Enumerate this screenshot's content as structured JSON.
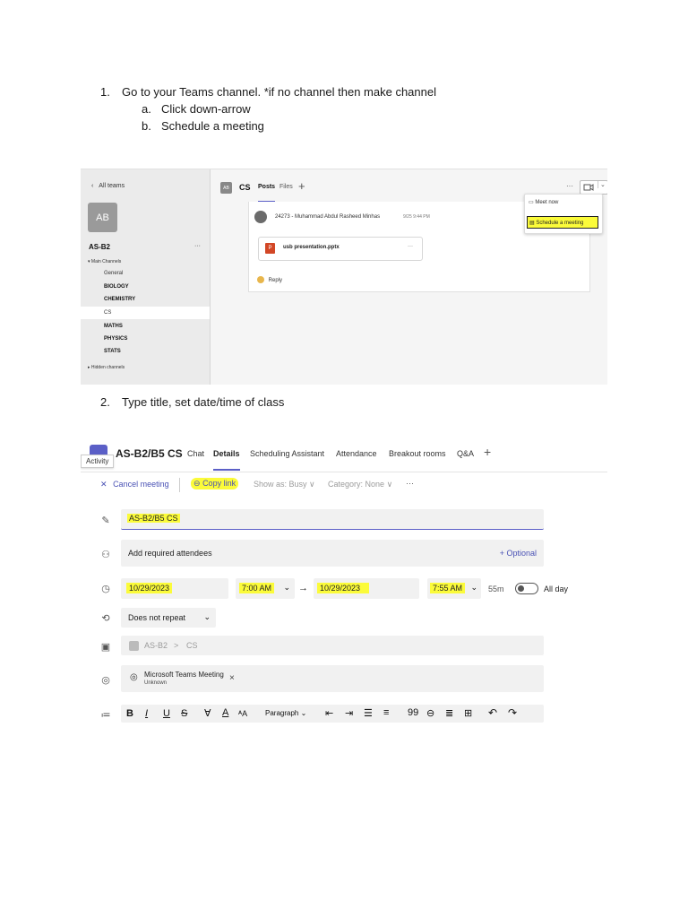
{
  "steps": [
    {
      "num": "1.",
      "text": "Go to your Teams channel. *if no channel then make channel",
      "subs": [
        {
          "letter": "a.",
          "text": "Click down-arrow"
        },
        {
          "letter": "b.",
          "text": "Schedule a meeting"
        }
      ]
    },
    {
      "num": "2.",
      "text": "Type title, set date/time of class"
    }
  ],
  "shot1": {
    "all_teams": "All teams",
    "team_initials": "AB",
    "team_name": "AS-B2",
    "more": "···",
    "main_channels": "Main Channels",
    "channels": [
      "General",
      "BIOLOGY",
      "CHEMISTRY",
      "CS",
      "MATHS",
      "PHYSICS",
      "STATS"
    ],
    "hidden_channels": "Hidden channels",
    "channel_initials": "AB",
    "channel_name": "CS",
    "tabs": [
      "Posts",
      "Files"
    ],
    "add": "+",
    "author": "24273 - Muhammad Abdul Rasheed Minhas",
    "timestamp": "9/25 9:44 PM",
    "file_name": "usb presentation.pptx",
    "reply": "Reply",
    "menu": [
      "Meet now",
      "Schedule a meeting"
    ]
  },
  "shot2": {
    "title": "AS-B2/B5 CS",
    "tabs": [
      "Chat",
      "Details",
      "Scheduling Assistant",
      "Attendance",
      "Breakout rooms",
      "Q&A"
    ],
    "active_tab": "Details",
    "add": "+",
    "tooltip": "Activity",
    "cancel": "Cancel meeting",
    "copy_link": "Copy link",
    "show_as": "Show as: Busy",
    "category": "Category: None",
    "more": "···",
    "title_value": "AS-B2/B5 CS",
    "attendees_placeholder": "Add required attendees",
    "optional": "+ Optional",
    "start_date": "10/29/2023",
    "start_time": "7:00 AM",
    "arrow": "→",
    "end_date": "10/29/2023",
    "end_time": "7:55 AM",
    "duration": "55m",
    "all_day": "All day",
    "repeat": "Does not repeat",
    "channel_team": "AS-B2",
    "channel_sep": ">",
    "channel_name": "CS",
    "location": "Microsoft Teams Meeting",
    "location_sub": "Unknown",
    "paragraph": "Paragraph"
  },
  "colors": {
    "highlight": "#fbfb3a",
    "teams_purple": "#5b5fc7",
    "link_blue": "#4a52b5"
  }
}
